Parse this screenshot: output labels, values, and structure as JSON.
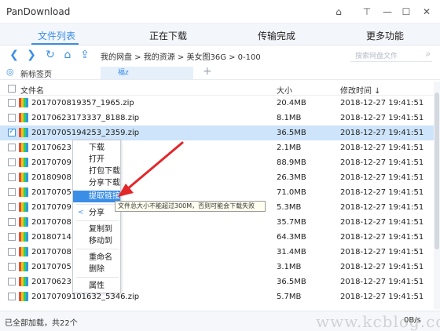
{
  "app": {
    "title": "PanDownload"
  },
  "window_controls": [
    "⌂",
    "⊤",
    "—",
    "☐",
    "✕"
  ],
  "nav": {
    "tabs": [
      {
        "label": "文件列表",
        "active": true
      },
      {
        "label": "正在下载",
        "active": false
      },
      {
        "label": "传输完成",
        "active": false
      },
      {
        "label": "更多功能",
        "active": false
      }
    ]
  },
  "toolbar": {
    "icons": [
      "back-arrow-icon",
      "forward-arrow-icon",
      "refresh-icon",
      "home-icon",
      "upload-icon"
    ],
    "breadcrumb": "我的网盘 > 我的资源 > 美女图36G > 0-100",
    "search_placeholder": "搜索网盘文件"
  },
  "tabs": {
    "new_tab_label": "新标签页",
    "current_tab": "福z",
    "add_symbol": "+"
  },
  "columns": {
    "name": "文件名",
    "size": "大小",
    "date": "修改时间 ↓"
  },
  "files": [
    {
      "name": "20170708193​57_1965.zip",
      "size": "20.4MB",
      "date": "2018-12-27 19:41:51",
      "checked": false
    },
    {
      "name": "20170623173337_8188.zip",
      "size": "8.1MB",
      "date": "2018-12-27 19:41:51",
      "checked": false
    },
    {
      "name": "20170705194253_2359.zip",
      "size": "36.5MB",
      "date": "2018-12-27 19:41:51",
      "checked": true
    },
    {
      "name": "2017062317",
      "size": "2.1MB",
      "date": "2018-12-27 19:41:51",
      "checked": false
    },
    {
      "name": "2017070910",
      "size": "88.9MB",
      "date": "2018-12-27 19:41:51",
      "checked": false
    },
    {
      "name": "2018090819",
      "size": "26.3MB",
      "date": "2018-12-27 19:41:51",
      "checked": false
    },
    {
      "name": "2017070519",
      "size": "71.0MB",
      "date": "2018-12-27 19:41:51",
      "checked": false
    },
    {
      "name": "2017070910",
      "size": "5.3MB",
      "date": "2018-12-27 19:41:51",
      "checked": false
    },
    {
      "name": "2017070819",
      "size": "35.7MB",
      "date": "2018-12-27 19:41:51",
      "checked": false
    },
    {
      "name": "2018071418",
      "size": "64.3MB",
      "date": "2018-12-27 19:41:51",
      "checked": false
    },
    {
      "name": "2017070819",
      "size": "31.4MB",
      "date": "2018-12-27 19:41:51",
      "checked": false
    },
    {
      "name": "2017070519",
      "size": "3.1MB",
      "date": "2018-12-27 19:41:51",
      "checked": false
    },
    {
      "name": "2017062317",
      "size": "36.5MB",
      "date": "2018-12-27 19:41:51",
      "checked": false
    },
    {
      "name": "20170709101632_5346.zip",
      "size": "5.7MB",
      "date": "2018-12-27 19:41:51",
      "checked": false
    }
  ],
  "context_menu": {
    "items": [
      {
        "label": "下载"
      },
      {
        "label": "打开"
      },
      {
        "label": "打包下载"
      },
      {
        "label": "分享下载"
      },
      {
        "label": "提取链接",
        "highlighted": true
      },
      {
        "label": "分享"
      },
      {
        "label": "复制到"
      },
      {
        "label": "移动到"
      },
      {
        "label": "重命名"
      },
      {
        "label": "删除"
      },
      {
        "label": "属性"
      }
    ]
  },
  "tooltip": {
    "text": "文件总大小不能超过300M，否则可能会下载失败"
  },
  "status": {
    "text": "已全部加载，共22个",
    "speed": "0B/s"
  },
  "watermark": {
    "text": "www.kcblog.com"
  },
  "colors": {
    "accent": "#3a8ee6",
    "selected_row": "#cde4fa",
    "arrow": "#e2262a"
  }
}
